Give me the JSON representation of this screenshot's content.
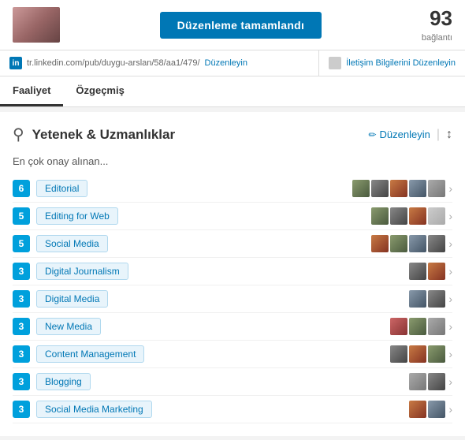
{
  "header": {
    "edit_done_label": "Düzenleme tamamlandı",
    "connections_number": "93",
    "connections_label": "bağlantı"
  },
  "url_bar": {
    "linkedin_icon_label": "in",
    "url_text": "tr.linkedin.com/pub/duygu-arslan/58/aa1/479/",
    "url_edit_label": "Düzenleyin",
    "contact_edit_label": "İletişim Bilgilerini Düzenleyin"
  },
  "tabs": [
    {
      "label": "Faaliyet",
      "active": true
    },
    {
      "label": "Özgeçmiş",
      "active": false
    }
  ],
  "section": {
    "icon": "⚙",
    "title": "Yetenek & Uzmanlıklar",
    "edit_label": "Düzenleyin",
    "endorsements_label": "En çok onay alınan..."
  },
  "skills": [
    {
      "count": "6",
      "name": "Editorial",
      "avatars": [
        "a1",
        "a2",
        "a3",
        "a4",
        "a5"
      ]
    },
    {
      "count": "5",
      "name": "Editing for Web",
      "avatars": [
        "a1",
        "a2",
        "a3",
        "ag"
      ]
    },
    {
      "count": "5",
      "name": "Social Media",
      "avatars": [
        "a3",
        "a1",
        "a4",
        "a2"
      ]
    },
    {
      "count": "3",
      "name": "Digital Journalism",
      "avatars": [
        "a2",
        "a3"
      ]
    },
    {
      "count": "3",
      "name": "Digital Media",
      "avatars": [
        "a4",
        "a2"
      ]
    },
    {
      "count": "3",
      "name": "New Media",
      "avatars": [
        "a6",
        "a1",
        "a5"
      ]
    },
    {
      "count": "3",
      "name": "Content Management",
      "avatars": [
        "a2",
        "a3",
        "a1"
      ]
    },
    {
      "count": "3",
      "name": "Blogging",
      "avatars": [
        "a5",
        "a2"
      ]
    },
    {
      "count": "3",
      "name": "Social Media Marketing",
      "avatars": [
        "a3",
        "a4"
      ]
    }
  ]
}
